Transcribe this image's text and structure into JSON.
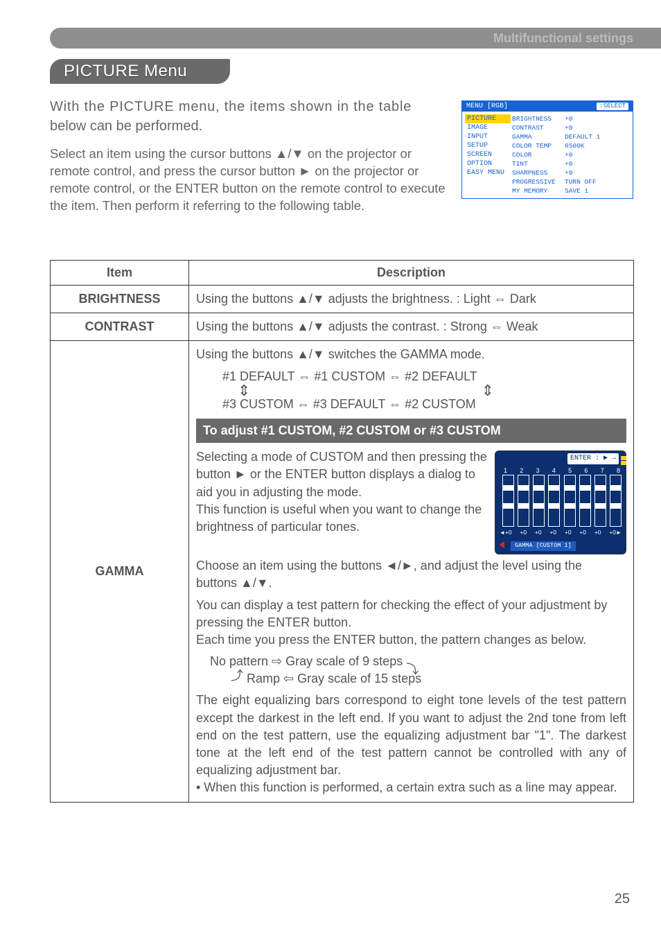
{
  "header": {
    "bar_text": "Multifunctional settings",
    "section_title": "PICTURE Menu"
  },
  "intro": {
    "p1_1": "With the PICTURE menu, the items shown in the table",
    "p1_2": "below can be performed.",
    "p2": "Select an item using the cursor buttons ▲/▼ on the projector or remote control, and press the cursor button ► on the projector or remote control, or the ENTER button on the remote control to execute the item. Then perform it referring to the following table."
  },
  "osd": {
    "title": "MENU [RGB]",
    "select_label": ":SELECT",
    "left_items": [
      "PICTURE",
      "IMAGE",
      "INPUT",
      "SETUP",
      "SCREEN",
      "OPTION",
      "EASY MENU"
    ],
    "right_rows": [
      {
        "label": "BRIGHTNESS",
        "val": "+0"
      },
      {
        "label": "CONTRAST",
        "val": "+0"
      },
      {
        "label": "GAMMA",
        "val": "DEFAULT 1"
      },
      {
        "label": "COLOR TEMP",
        "val": "6500K"
      },
      {
        "label": "COLOR",
        "val": "+0"
      },
      {
        "label": "TINT",
        "val": "+0"
      },
      {
        "label": "SHARPNESS",
        "val": "+0"
      },
      {
        "label": "PROGRESSIVE",
        "val": "TURN OFF"
      },
      {
        "label": "MY MEMORY",
        "val": "SAVE 1"
      }
    ]
  },
  "table": {
    "head_item": "Item",
    "head_desc": "Description",
    "brightness": {
      "item": "BRIGHTNESS",
      "desc": "Using the buttons ▲/▼ adjusts the brightness. :    Light ⇔ Dark"
    },
    "contrast": {
      "item": "CONTRAST",
      "desc": "Using the buttons ▲/▼ adjusts the contrast. :    Strong ⇔ Weak"
    },
    "gamma": {
      "item": "GAMMA",
      "line1": "Using the buttons ▲/▼ switches the GAMMA mode.",
      "diag_l1": "#1 DEFAULT ⇔ #1 CUSTOM ⇔ #2 DEFAULT",
      "diag_l2": "#3 CUSTOM ⇔ #3 DEFAULT ⇔ #2 CUSTOM",
      "subheader": "To adjust #1 CUSTOM, #2 CUSTOM or #3 CUSTOM",
      "para1": "Selecting a mode of CUSTOM and then pressing the button ► or the ENTER button displays a dialog to aid you in adjusting the mode.",
      "para1b": "This function is useful when you want to change the brightness of particular tones.",
      "para2": "Choose an item using the buttons ◄/►, and adjust the level using the buttons ▲/▼.",
      "para3": "You can display a test pattern for checking the effect of your adjustment by pressing the ENTER button.",
      "para3b": "Each time you press the ENTER button, the pattern changes as below.",
      "flow1": "No pattern ⇨ Gray scale of 9 steps",
      "flow2": "Ramp ⇦ Gray scale of 15 steps",
      "para4": "The eight equalizing bars correspond to eight tone levels of the test pattern except the darkest in the left end. If you want to adjust the 2nd tone from left end on the test pattern, use the equalizing adjustment bar \"1\". The darkest tone at the left end of the test pattern cannot be controlled with any of equalizing adjustment bar.",
      "para5": "• When this function is performed, a certain extra such as a line may appear.",
      "enter_label": "ENTER :",
      "eq_numbers": [
        "1",
        "2",
        "3",
        "4",
        "5",
        "6",
        "7",
        "8"
      ],
      "eq_values": [
        "+0",
        "+0",
        "+0",
        "+0",
        "+0",
        "+0",
        "+0",
        "+0"
      ],
      "custom_badge": "GAMMA [CUSTOM 1]"
    }
  },
  "page_number": "25"
}
